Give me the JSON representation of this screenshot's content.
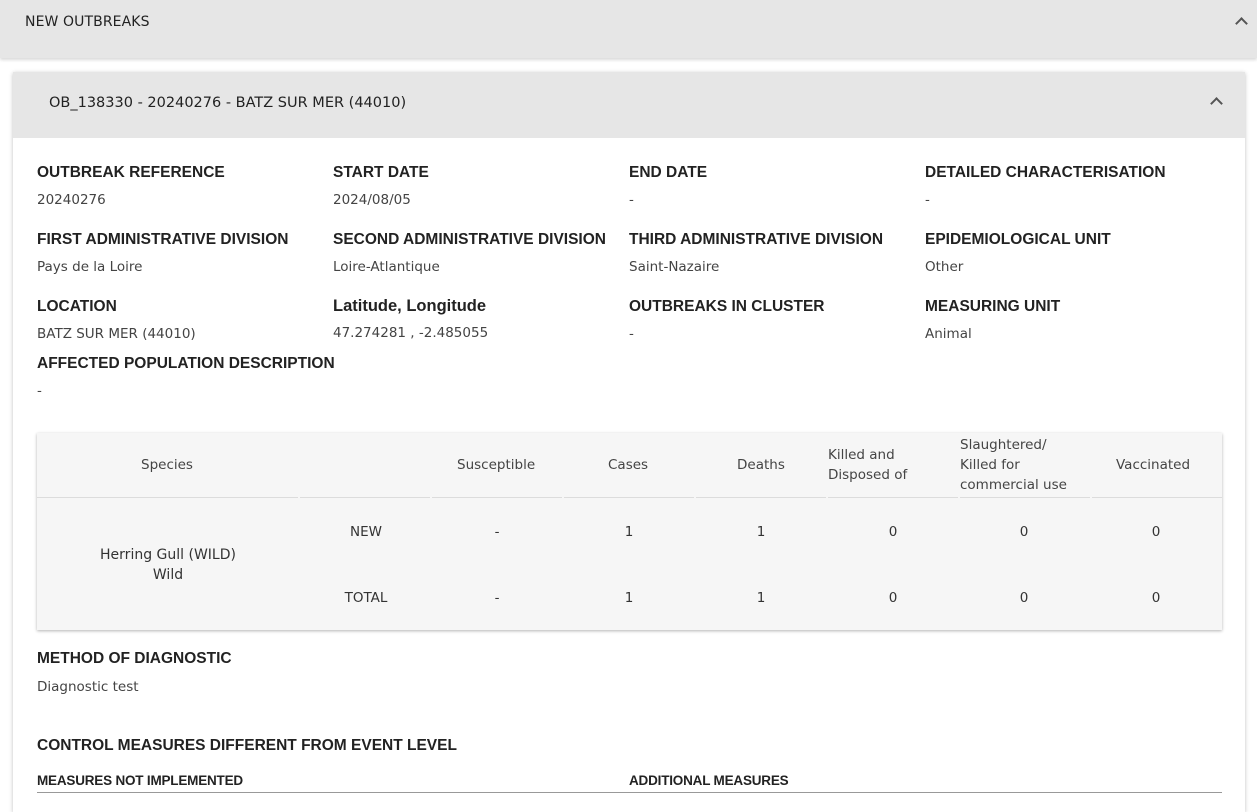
{
  "top_panel": {
    "title": "NEW OUTBREAKS"
  },
  "outbreak": {
    "header": "OB_138330 - 20240276 - BATZ SUR MER (44010)",
    "fields": {
      "outbreak_reference": {
        "label": "OUTBREAK REFERENCE",
        "value": "20240276"
      },
      "start_date": {
        "label": "START DATE",
        "value": "2024/08/05"
      },
      "end_date": {
        "label": "END DATE",
        "value": "-"
      },
      "detailed_characterisation": {
        "label": "DETAILED CHARACTERISATION",
        "value": "-"
      },
      "first_admin": {
        "label": "FIRST ADMINISTRATIVE DIVISION",
        "value": "Pays de la Loire"
      },
      "second_admin": {
        "label": "SECOND ADMINISTRATIVE DIVISION",
        "value": "Loire-Atlantique"
      },
      "third_admin": {
        "label": "THIRD ADMINISTRATIVE DIVISION",
        "value": "Saint-Nazaire"
      },
      "epi_unit": {
        "label": "EPIDEMIOLOGICAL UNIT",
        "value": "Other"
      },
      "location": {
        "label": "LOCATION",
        "value": "BATZ SUR MER (44010)"
      },
      "lat_long": {
        "label": "Latitude, Longitude",
        "value": "47.274281 , -2.485055"
      },
      "outbreaks_in_cluster": {
        "label": "OUTBREAKS IN CLUSTER",
        "value": "-"
      },
      "measuring_unit": {
        "label": "MEASURING UNIT",
        "value": "Animal"
      },
      "affected_population": {
        "label": "AFFECTED POPULATION DESCRIPTION",
        "value": "-"
      }
    },
    "table": {
      "headers": {
        "species": "Species",
        "susceptible": "Susceptible",
        "cases": "Cases",
        "deaths": "Deaths",
        "killed_line1": "Killed and",
        "killed_line2": "Disposed of",
        "slaughtered_line1": "Slaughtered/",
        "slaughtered_line2": "Killed for",
        "slaughtered_line3": "commercial use",
        "vaccinated": "Vaccinated"
      },
      "species_line1": "Herring Gull (WILD)",
      "species_line2": "Wild",
      "rows": [
        {
          "label": "NEW",
          "susceptible": "-",
          "cases": "1",
          "deaths": "1",
          "killed": "0",
          "slaughtered": "0",
          "vaccinated": "0"
        },
        {
          "label": "TOTAL",
          "susceptible": "-",
          "cases": "1",
          "deaths": "1",
          "killed": "0",
          "slaughtered": "0",
          "vaccinated": "0"
        }
      ]
    },
    "method_of_diagnostic": {
      "label": "METHOD OF DIAGNOSTIC",
      "value": "Diagnostic test"
    },
    "control_measures": {
      "title": "CONTROL MEASURES DIFFERENT FROM EVENT LEVEL",
      "not_implemented": "MEASURES NOT IMPLEMENTED",
      "additional": "ADDITIONAL MEASURES"
    }
  }
}
